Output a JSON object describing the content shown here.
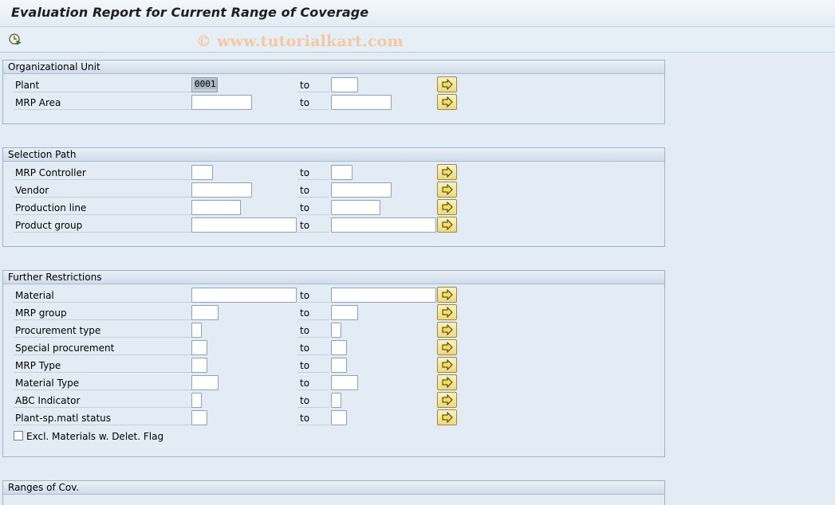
{
  "window": {
    "title": "Evaluation Report for Current Range of Coverage"
  },
  "toolbar": {
    "execute_icon": "execute-icon",
    "watermark": "© www.tutorialkart.com"
  },
  "common": {
    "to_label": "to",
    "multiple_selection_icon": "arrow-right-icon"
  },
  "sections": {
    "org_unit": {
      "title": "Organizational Unit",
      "rows": [
        {
          "label": "Plant",
          "low": "0001",
          "high": ""
        },
        {
          "label": "MRP Area",
          "low": "",
          "high": ""
        }
      ]
    },
    "selection_path": {
      "title": "Selection Path",
      "rows": [
        {
          "label": "MRP Controller",
          "low": "",
          "high": ""
        },
        {
          "label": "Vendor",
          "low": "",
          "high": ""
        },
        {
          "label": "Production line",
          "low": "",
          "high": ""
        },
        {
          "label": "Product group",
          "low": "",
          "high": ""
        }
      ]
    },
    "further_restrictions": {
      "title": "Further Restrictions",
      "rows": [
        {
          "label": "Material",
          "low": "",
          "high": ""
        },
        {
          "label": "MRP group",
          "low": "",
          "high": ""
        },
        {
          "label": "Procurement type",
          "low": "",
          "high": ""
        },
        {
          "label": "Special procurement",
          "low": "",
          "high": ""
        },
        {
          "label": "MRP Type",
          "low": "",
          "high": ""
        },
        {
          "label": "Material Type",
          "low": "",
          "high": ""
        },
        {
          "label": "ABC Indicator",
          "low": "",
          "high": ""
        },
        {
          "label": "Plant-sp.matl status",
          "low": "",
          "high": ""
        }
      ],
      "checkbox": {
        "label": "Excl. Materials w. Delet. Flag",
        "checked": false
      }
    },
    "ranges_of_cov": {
      "title": "Ranges of Cov."
    }
  }
}
